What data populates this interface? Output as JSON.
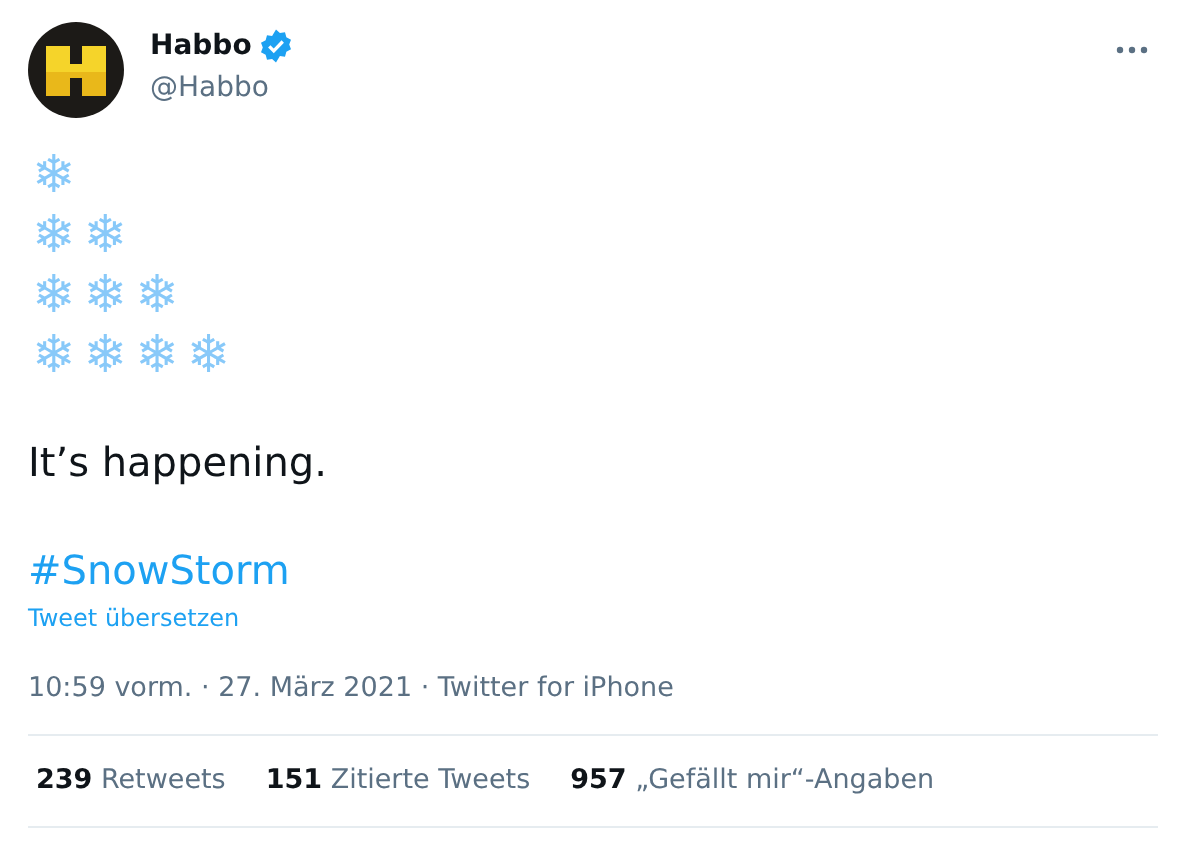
{
  "author": {
    "name": "Habbo",
    "verified": true,
    "handle": "@Habbo"
  },
  "emoji_lines": [
    "❄",
    "❄❄",
    "❄❄❄",
    "❄❄❄❄"
  ],
  "text": "It’s happening.",
  "hashtag": "#SnowStorm",
  "translate": "Tweet übersetzen",
  "meta": "10:59 vorm. · 27. März 2021 · Twitter for iPhone",
  "stats": [
    {
      "count": "239",
      "label": "Retweets"
    },
    {
      "count": "151",
      "label": "Zitierte Tweets"
    },
    {
      "count": "957",
      "label": "„Gefällt mir“-Angaben"
    }
  ]
}
